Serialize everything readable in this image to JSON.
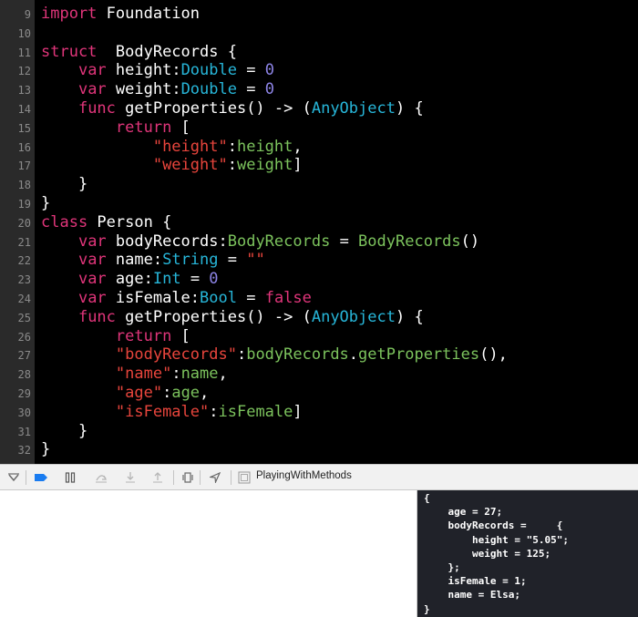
{
  "editor": {
    "lines": [
      {
        "n": "9",
        "tokens": [
          {
            "t": "import",
            "c": "kw"
          },
          {
            "t": " Foundation",
            "c": "pl"
          }
        ]
      },
      {
        "n": "10",
        "tokens": []
      },
      {
        "n": "11",
        "tokens": [
          {
            "t": "struct",
            "c": "kw"
          },
          {
            "t": "  BodyRecords {",
            "c": "pl"
          }
        ]
      },
      {
        "n": "12",
        "tokens": [
          {
            "t": "    ",
            "c": "pl"
          },
          {
            "t": "var",
            "c": "kw"
          },
          {
            "t": " height:",
            "c": "pl"
          },
          {
            "t": "Double",
            "c": "ty"
          },
          {
            "t": " = ",
            "c": "pl"
          },
          {
            "t": "0",
            "c": "num"
          }
        ]
      },
      {
        "n": "13",
        "tokens": [
          {
            "t": "    ",
            "c": "pl"
          },
          {
            "t": "var",
            "c": "kw"
          },
          {
            "t": " weight:",
            "c": "pl"
          },
          {
            "t": "Double",
            "c": "ty"
          },
          {
            "t": " = ",
            "c": "pl"
          },
          {
            "t": "0",
            "c": "num"
          }
        ]
      },
      {
        "n": "14",
        "tokens": [
          {
            "t": "    ",
            "c": "pl"
          },
          {
            "t": "func",
            "c": "kw"
          },
          {
            "t": " getProperties() -> (",
            "c": "pl"
          },
          {
            "t": "AnyObject",
            "c": "ty"
          },
          {
            "t": ") {",
            "c": "pl"
          }
        ]
      },
      {
        "n": "15",
        "tokens": [
          {
            "t": "        ",
            "c": "pl"
          },
          {
            "t": "return",
            "c": "kw"
          },
          {
            "t": " [",
            "c": "pl"
          }
        ]
      },
      {
        "n": "16",
        "tokens": [
          {
            "t": "            ",
            "c": "pl"
          },
          {
            "t": "\"height\"",
            "c": "str"
          },
          {
            "t": ":",
            "c": "pl"
          },
          {
            "t": "height",
            "c": "fn"
          },
          {
            "t": ",",
            "c": "pl"
          }
        ]
      },
      {
        "n": "17",
        "tokens": [
          {
            "t": "            ",
            "c": "pl"
          },
          {
            "t": "\"weight\"",
            "c": "str"
          },
          {
            "t": ":",
            "c": "pl"
          },
          {
            "t": "weight",
            "c": "fn"
          },
          {
            "t": "]",
            "c": "pl"
          }
        ]
      },
      {
        "n": "18",
        "tokens": [
          {
            "t": "    }",
            "c": "pl"
          }
        ]
      },
      {
        "n": "19",
        "tokens": [
          {
            "t": "}",
            "c": "pl"
          }
        ]
      },
      {
        "n": "20",
        "tokens": [
          {
            "t": "class",
            "c": "kw"
          },
          {
            "t": " Person {",
            "c": "pl"
          }
        ]
      },
      {
        "n": "21",
        "tokens": [
          {
            "t": "    ",
            "c": "pl"
          },
          {
            "t": "var",
            "c": "kw"
          },
          {
            "t": " bodyRecords:",
            "c": "pl"
          },
          {
            "t": "BodyRecords",
            "c": "fn"
          },
          {
            "t": " = ",
            "c": "pl"
          },
          {
            "t": "BodyRecords",
            "c": "fn"
          },
          {
            "t": "()",
            "c": "pl"
          }
        ]
      },
      {
        "n": "22",
        "tokens": [
          {
            "t": "    ",
            "c": "pl"
          },
          {
            "t": "var",
            "c": "kw"
          },
          {
            "t": " name:",
            "c": "pl"
          },
          {
            "t": "String",
            "c": "ty"
          },
          {
            "t": " = ",
            "c": "pl"
          },
          {
            "t": "\"\"",
            "c": "str"
          }
        ]
      },
      {
        "n": "23",
        "tokens": [
          {
            "t": "    ",
            "c": "pl"
          },
          {
            "t": "var",
            "c": "kw"
          },
          {
            "t": " age:",
            "c": "pl"
          },
          {
            "t": "Int",
            "c": "ty"
          },
          {
            "t": " = ",
            "c": "pl"
          },
          {
            "t": "0",
            "c": "num"
          }
        ]
      },
      {
        "n": "24",
        "tokens": [
          {
            "t": "    ",
            "c": "pl"
          },
          {
            "t": "var",
            "c": "kw"
          },
          {
            "t": " isFemale:",
            "c": "pl"
          },
          {
            "t": "Bool",
            "c": "ty"
          },
          {
            "t": " = ",
            "c": "pl"
          },
          {
            "t": "false",
            "c": "kw"
          }
        ]
      },
      {
        "n": "25",
        "tokens": [
          {
            "t": "    ",
            "c": "pl"
          },
          {
            "t": "func",
            "c": "kw"
          },
          {
            "t": " getProperties() -> (",
            "c": "pl"
          },
          {
            "t": "AnyObject",
            "c": "ty"
          },
          {
            "t": ") {",
            "c": "pl"
          }
        ]
      },
      {
        "n": "26",
        "tokens": [
          {
            "t": "        ",
            "c": "pl"
          },
          {
            "t": "return",
            "c": "kw"
          },
          {
            "t": " [",
            "c": "pl"
          }
        ]
      },
      {
        "n": "27",
        "tokens": [
          {
            "t": "        ",
            "c": "pl"
          },
          {
            "t": "\"bodyRecords\"",
            "c": "str"
          },
          {
            "t": ":",
            "c": "pl"
          },
          {
            "t": "bodyRecords",
            "c": "fn"
          },
          {
            "t": ".",
            "c": "pl"
          },
          {
            "t": "getProperties",
            "c": "fn"
          },
          {
            "t": "(),",
            "c": "pl"
          }
        ]
      },
      {
        "n": "28",
        "tokens": [
          {
            "t": "        ",
            "c": "pl"
          },
          {
            "t": "\"name\"",
            "c": "str"
          },
          {
            "t": ":",
            "c": "pl"
          },
          {
            "t": "name",
            "c": "fn"
          },
          {
            "t": ",",
            "c": "pl"
          }
        ]
      },
      {
        "n": "29",
        "tokens": [
          {
            "t": "        ",
            "c": "pl"
          },
          {
            "t": "\"age\"",
            "c": "str"
          },
          {
            "t": ":",
            "c": "pl"
          },
          {
            "t": "age",
            "c": "fn"
          },
          {
            "t": ",",
            "c": "pl"
          }
        ]
      },
      {
        "n": "30",
        "tokens": [
          {
            "t": "        ",
            "c": "pl"
          },
          {
            "t": "\"isFemale\"",
            "c": "str"
          },
          {
            "t": ":",
            "c": "pl"
          },
          {
            "t": "isFemale",
            "c": "fn"
          },
          {
            "t": "]",
            "c": "pl"
          }
        ]
      },
      {
        "n": "31",
        "tokens": [
          {
            "t": "    }",
            "c": "pl"
          }
        ]
      },
      {
        "n": "32",
        "tokens": [
          {
            "t": "}",
            "c": "pl"
          }
        ]
      }
    ]
  },
  "debug_bar": {
    "target_name": "PlayingWithMethods",
    "icons": [
      "hide-debug-area-icon",
      "breakpoints-toggle-icon",
      "pause-icon",
      "step-over-icon",
      "step-into-icon",
      "step-out-icon",
      "view-debugger-icon",
      "simulate-location-icon",
      "target-icon"
    ]
  },
  "console": {
    "lines": [
      "{",
      "    age = 27;",
      "    bodyRecords =     {",
      "        height = \"5.05\";",
      "        weight = 125;",
      "    };",
      "    isFemale = 1;",
      "    name = Elsa;",
      "}"
    ]
  },
  "colors": {
    "keyword": "#e0357a",
    "type": "#27b6d9",
    "number": "#8d84e6",
    "string": "#e8453c",
    "identifier": "#7cc35d",
    "editor_bg": "#000000",
    "console_bg": "#202229"
  }
}
